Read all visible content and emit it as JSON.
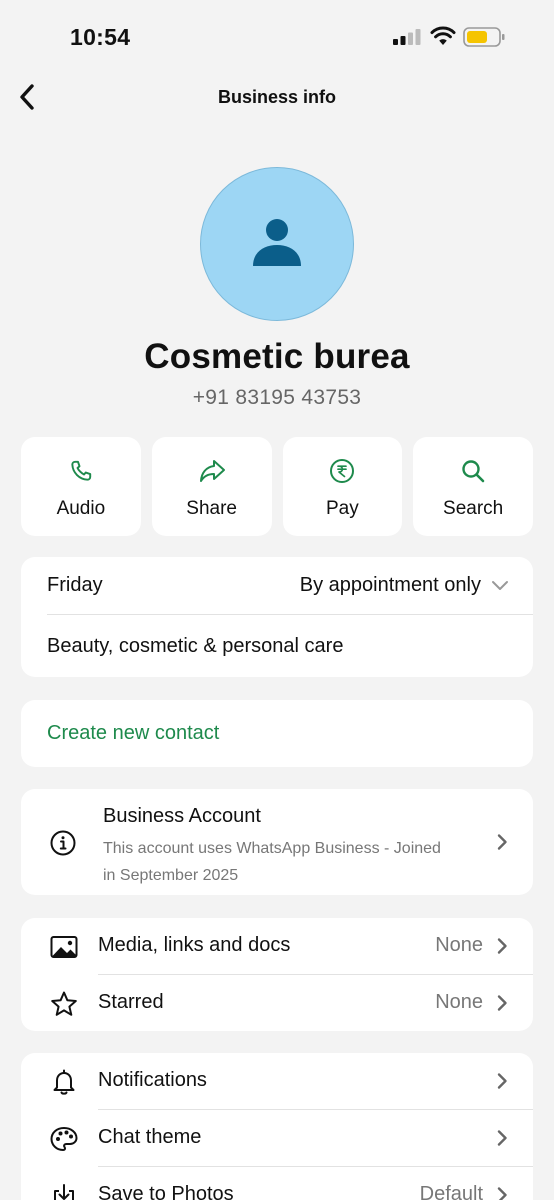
{
  "status_bar": {
    "time": "10:54",
    "battery_color": "#f5c400"
  },
  "header": {
    "title": "Business info",
    "back_icon": "chevron-left-icon"
  },
  "profile": {
    "name": "Cosmetic burea",
    "phone": "+91 83195 43753",
    "avatar_icon": "person-icon",
    "avatar_color": "#9dd6f4"
  },
  "actions": [
    {
      "label": "Audio",
      "icon": "phone-icon"
    },
    {
      "label": "Share",
      "icon": "share-arrow-icon"
    },
    {
      "label": "Pay",
      "icon": "rupee-icon"
    },
    {
      "label": "Search",
      "icon": "search-icon"
    }
  ],
  "business_hours": {
    "day": "Friday",
    "value": "By appointment only"
  },
  "category": "Beauty, cosmetic & personal care",
  "create_contact": "Create new contact",
  "business_account": {
    "title": "Business Account",
    "subtitle": "This account uses WhatsApp Business - Joined in September 2025"
  },
  "media_section": [
    {
      "label": "Media, links and docs",
      "value": "None",
      "icon": "image-icon"
    },
    {
      "label": "Starred",
      "value": "None",
      "icon": "star-icon"
    }
  ],
  "settings_section": [
    {
      "label": "Notifications",
      "value": "",
      "icon": "bell-icon"
    },
    {
      "label": "Chat theme",
      "value": "",
      "icon": "palette-icon"
    },
    {
      "label": "Save to Photos",
      "value": "Default",
      "icon": "download-icon"
    }
  ],
  "accent_color": "#1e8a4c"
}
